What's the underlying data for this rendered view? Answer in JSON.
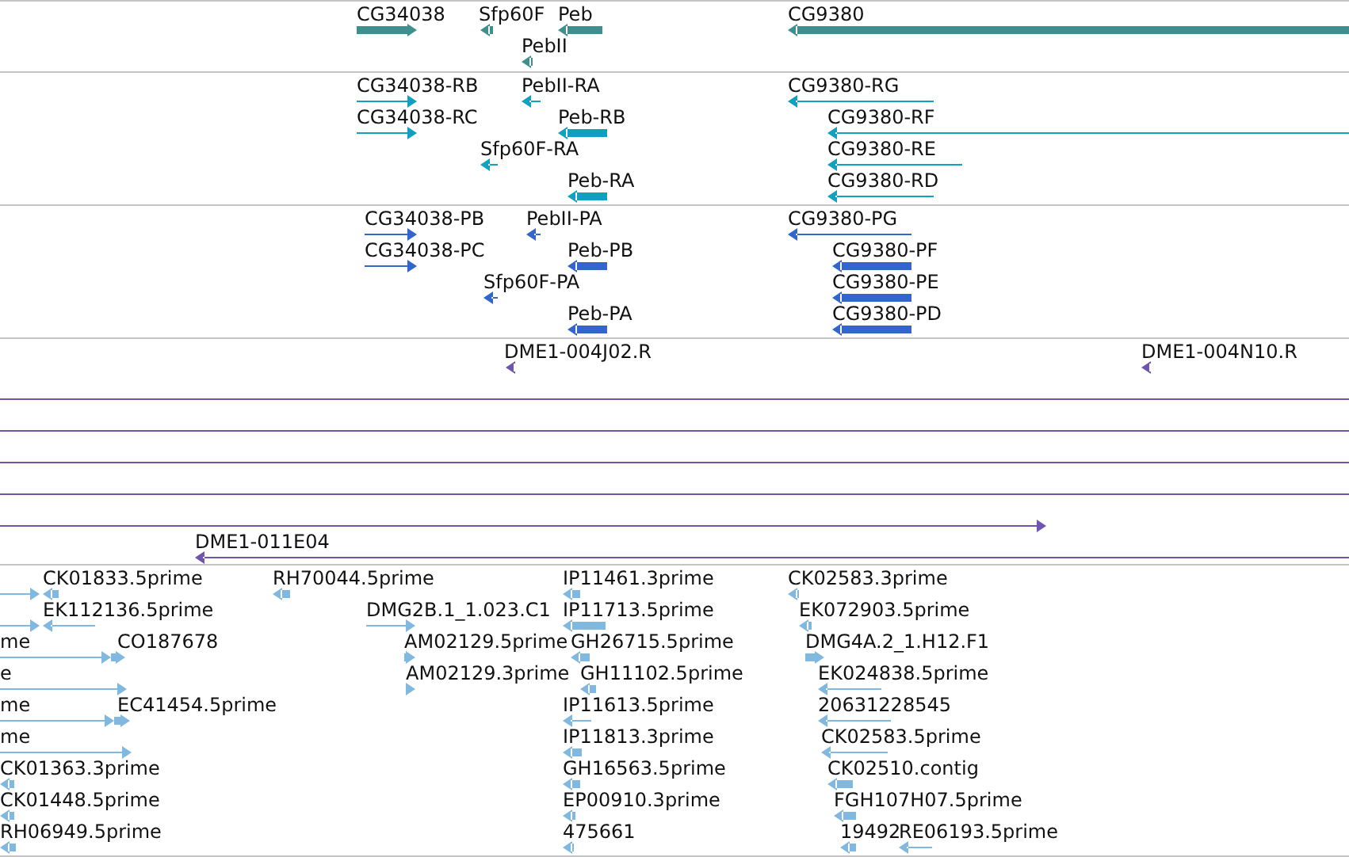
{
  "tracks": [
    {
      "color": "#3f8f8f",
      "features": [
        {
          "label": "CG34038",
          "reverse": false
        },
        {
          "label": "Sfp60F",
          "reverse": true
        },
        {
          "label": "Peb",
          "reverse": true
        },
        {
          "label": "PebII",
          "reverse": true
        },
        {
          "label": "CG9380",
          "reverse": true
        }
      ]
    },
    {
      "color": "#12a0c0",
      "features": [
        {
          "label": "CG34038-RB",
          "reverse": false
        },
        {
          "label": "PebII-RA",
          "reverse": true
        },
        {
          "label": "CG9380-RG",
          "reverse": true
        },
        {
          "label": "CG34038-RC",
          "reverse": false
        },
        {
          "label": "Peb-RB",
          "reverse": true
        },
        {
          "label": "CG9380-RF",
          "reverse": true
        },
        {
          "label": "Sfp60F-RA",
          "reverse": true
        },
        {
          "label": "CG9380-RE",
          "reverse": true
        },
        {
          "label": "Peb-RA",
          "reverse": true
        },
        {
          "label": "CG9380-RD",
          "reverse": true
        }
      ]
    },
    {
      "color": "#3366cc",
      "features": [
        {
          "label": "CG34038-PB",
          "reverse": false
        },
        {
          "label": "PebII-PA",
          "reverse": true
        },
        {
          "label": "CG9380-PG",
          "reverse": true
        },
        {
          "label": "CG34038-PC",
          "reverse": false
        },
        {
          "label": "Peb-PB",
          "reverse": true
        },
        {
          "label": "CG9380-PF",
          "reverse": true
        },
        {
          "label": "Sfp60F-PA",
          "reverse": true
        },
        {
          "label": "CG9380-PE",
          "reverse": true
        },
        {
          "label": "Peb-PA",
          "reverse": true
        },
        {
          "label": "CG9380-PD",
          "reverse": true
        }
      ]
    },
    {
      "color": "#7055b0",
      "features": [
        {
          "label": "DME1-004J02.R",
          "reverse": true
        },
        {
          "label": "DME1-004N10.R",
          "reverse": true
        },
        {
          "headless": true
        },
        {
          "headless": true
        },
        {
          "headless": true
        },
        {
          "headless": true
        },
        {
          "reverse": false
        },
        {
          "label": "DME1-011E04",
          "reverse": true
        }
      ]
    },
    {
      "color": "#80b8e0",
      "features": [
        {
          "reverse": false
        },
        {
          "label": "CK01833.5prime",
          "reverse": true
        },
        {
          "label": "RH70044.5prime",
          "reverse": true
        },
        {
          "label": "IP11461.3prime",
          "reverse": true
        },
        {
          "label": "CK02583.3prime",
          "reverse": true
        },
        {
          "reverse": false
        },
        {
          "label": "EK112136.5prime",
          "reverse": true
        },
        {
          "label": "DMG2B.1_1.023.C1",
          "reverse": false
        },
        {
          "label": "IP11713.5prime",
          "reverse": true
        },
        {
          "label": "EK072903.5prime",
          "reverse": true
        },
        {
          "label": "me",
          "reverse": false
        },
        {
          "label": "CO187678",
          "reverse": false
        },
        {
          "label": "AM02129.5prime",
          "reverse": false
        },
        {
          "label": "GH26715.5prime",
          "reverse": true
        },
        {
          "label": "DMG4A.2_1.H12.F1",
          "reverse": false
        },
        {
          "label": "e",
          "reverse": false
        },
        {
          "label": "AM02129.3prime",
          "reverse": false
        },
        {
          "label": "GH11102.5prime",
          "reverse": true
        },
        {
          "label": "EK024838.5prime",
          "reverse": true
        },
        {
          "label": "me",
          "reverse": false
        },
        {
          "label": "EC41454.5prime",
          "reverse": false
        },
        {
          "label": "IP11613.5prime",
          "reverse": true
        },
        {
          "label": "20631228545",
          "reverse": true
        },
        {
          "label": "me",
          "reverse": false
        },
        {
          "label": "IP11813.3prime",
          "reverse": true
        },
        {
          "label": "CK02583.5prime",
          "reverse": true
        },
        {
          "label": "CK01363.3prime",
          "reverse": true
        },
        {
          "label": "GH16563.5prime",
          "reverse": true
        },
        {
          "label": "CK02510.contig",
          "reverse": true
        },
        {
          "label": "CK01448.5prime",
          "reverse": true
        },
        {
          "label": "EP00910.3prime",
          "reverse": true
        },
        {
          "label": "FGH107H07.5prime",
          "reverse": true
        },
        {
          "label": "RH06949.5prime",
          "reverse": true
        },
        {
          "label": "475661",
          "reverse": true
        },
        {
          "label": "19492",
          "reverse": true
        },
        {
          "label": "RE06193.5prime",
          "reverse": true
        }
      ]
    }
  ]
}
